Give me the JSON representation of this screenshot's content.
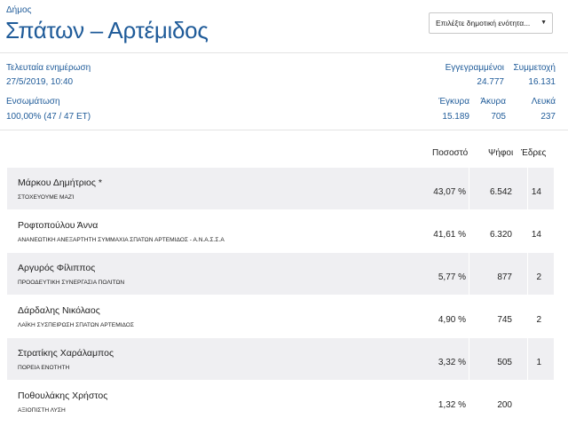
{
  "header": {
    "municipality_label": "Δήμος",
    "municipality_name": "Σπάτων – Αρτέμιδος",
    "unit_select": {
      "selected": "Επιλέξτε δημοτική ενότητα...",
      "caret_icon": "caret-down-icon"
    }
  },
  "info": {
    "last_update_label": "Τελευταία ενημέρωση",
    "last_update_value": "27/5/2019, 10:40",
    "integration_label": "Ενσωμάτωση",
    "integration_value": "100,00% (47 / 47 ΕΤ)",
    "registered_label": "Εγγεγραμμένοι",
    "registered_value": "24.777",
    "turnout_label": "Συμμετοχή",
    "turnout_value": "16.131",
    "valid_label": "Έγκυρα",
    "valid_value": "15.189",
    "invalid_label": "Άκυρα",
    "invalid_value": "705",
    "blank_label": "Λευκά",
    "blank_value": "237"
  },
  "table": {
    "headers": {
      "percent": "Ποσοστό",
      "votes": "Ψήφοι",
      "seats": "Έδρες"
    },
    "rows": [
      {
        "candidate": "Μάρκου Δημήτριος *",
        "party": "ΣΤΟΧΕΥΟΥΜΕ μαζί",
        "percent": "43,07 %",
        "votes": "6.542",
        "seats": "14"
      },
      {
        "candidate": "Ροφτοπούλου Άννα",
        "party": "ΑΝΑΝΕΩΤΙΚΗ ΑΝΕΞΑΡΤΗΤΗ ΣΥΜΜΑΧΙΑ ΣΠΑΤΩΝ ΑΡΤΕΜΙΔΟΣ - Α.Ν.Α.Σ.Σ.Α",
        "percent": "41,61 %",
        "votes": "6.320",
        "seats": "14"
      },
      {
        "candidate": "Αργυρός Φίλιππος",
        "party": "ΠΡΟΟΔΕΥΤΙΚΗ ΣΥΝΕΡΓΑΣΙΑ ΠΟΛΙΤΩΝ",
        "percent": "5,77 %",
        "votes": "877",
        "seats": "2"
      },
      {
        "candidate": "Δάρδαλης Νικόλαος",
        "party": "ΛΑΪΚΗ ΣΥΣΠΕΙΡΩΣΗ ΣΠΑΤΩΝ ΑΡΤΕΜΙΔΟΣ",
        "percent": "4,90 %",
        "votes": "745",
        "seats": "2"
      },
      {
        "candidate": "Στρατίκης Χαράλαμπος",
        "party": "ΠΟΡΕΙΑ ΕΝΟΤΗΤΗ",
        "percent": "3,32 %",
        "votes": "505",
        "seats": "1"
      },
      {
        "candidate": "Ποθουλάκης Χρήστος",
        "party": "ΑΞΙΟΠΙΣΤΗ ΛΥΣΗ",
        "percent": "1,32 %",
        "votes": "200",
        "seats": ""
      }
    ]
  },
  "colors": {
    "accent": "#1f5b99",
    "row_shade": "#efeff2",
    "divider": "#e3e3e3"
  }
}
